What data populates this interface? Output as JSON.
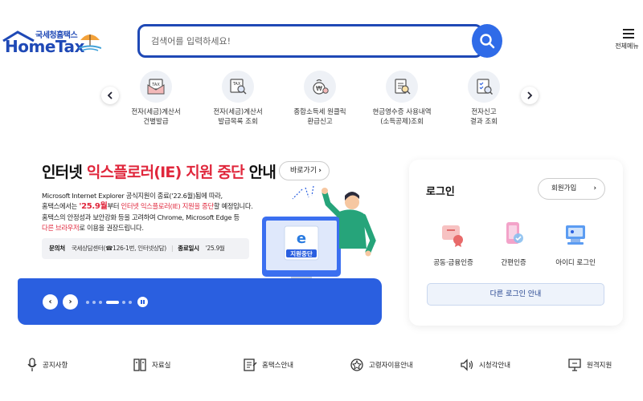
{
  "header": {
    "logo_sub": "국세청홈택스",
    "logo_main": "HomeTax",
    "search_placeholder": "검색어를 입력하세요!",
    "menu_label": "전체메뉴"
  },
  "quick_menu": [
    {
      "line1": "전자(세금)계산서",
      "line2": "건별발급",
      "icon": "tax-invoice-icon"
    },
    {
      "line1": "전자(세금)계산서",
      "line2": "발급목록 조회",
      "icon": "tax-invoice-search-icon"
    },
    {
      "line1": "종합소득세 원클릭",
      "line2": "환급신고",
      "icon": "income-tax-refund-icon"
    },
    {
      "line1": "현금영수증 사용내역",
      "line2": "(소득공제)조회",
      "icon": "cash-receipt-search-icon"
    },
    {
      "line1": "전자신고",
      "line2": "결과 조회",
      "icon": "e-filing-result-icon"
    }
  ],
  "banner": {
    "title_part1": "인터넷 ",
    "title_red": "익스플로러(IE) 지원 중단",
    "title_part3": " 안내",
    "goto_label": "바로가기",
    "desc_line1": "Microsoft Internet Explorer 공식지원이 종료('22.6월)됨에 따라,",
    "desc_line2_pre": "홈택스에서는 ",
    "desc_line2_big": "'25.9월",
    "desc_line2_mid": "부터 ",
    "desc_line2_red": "인터넷 익스플로러(IE) 지원을 중단",
    "desc_line2_post": "할 예정입니다.",
    "desc_line3": "홈택스의 안정성과 보안강화 등을 고려하여 Chrome, Microsoft Edge 등",
    "desc_line4_red": "다른 브라우저",
    "desc_line4_post": "로 이용을 권장드립니다.",
    "info_label": "문의처",
    "info_value": "국세상담센터(☎126-1번, 인터넷상담)",
    "end_label": "종료일시",
    "end_value": "'25.9월",
    "illus_caption": "지원중단"
  },
  "carousel": {
    "prev": "‹",
    "next": "›",
    "slides": 6,
    "active": 4
  },
  "login": {
    "title": "로그인",
    "join_label": "회원가입",
    "options": [
      {
        "label": "공동·금융인증",
        "icon": "certificate-icon"
      },
      {
        "label": "간편인증",
        "icon": "simple-auth-icon"
      },
      {
        "label": "아이디 로그인",
        "icon": "id-login-icon"
      }
    ],
    "other_label": "다른 로그인 안내"
  },
  "bottom_links": [
    {
      "label": "공지사항",
      "icon": "microphone-icon"
    },
    {
      "label": "자료실",
      "icon": "archive-icon"
    },
    {
      "label": "홈택스안내",
      "icon": "guide-icon"
    },
    {
      "label": "고령자이용안내",
      "icon": "elderly-guide-icon"
    },
    {
      "label": "시청각안내",
      "icon": "speaker-icon"
    },
    {
      "label": "원격지원",
      "icon": "remote-support-icon"
    }
  ],
  "colors": {
    "brand_blue": "#1f49b6",
    "accent_blue": "#2a5fe0",
    "alert_red": "#e0273c"
  }
}
